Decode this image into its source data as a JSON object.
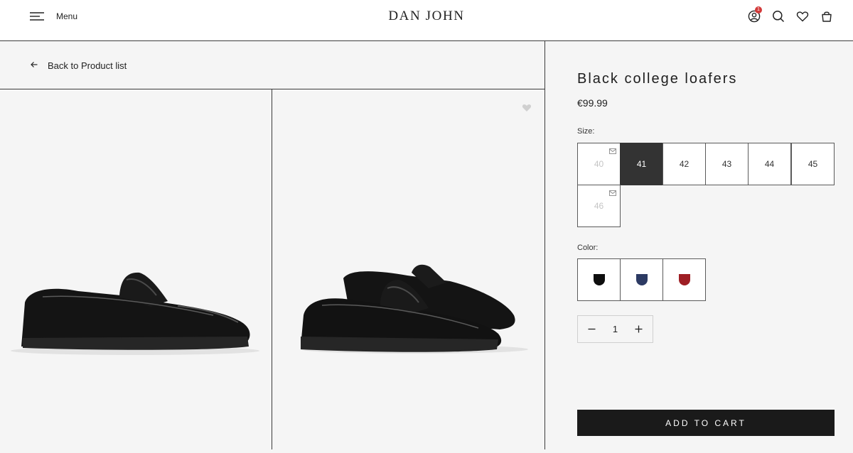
{
  "header": {
    "menu_label": "Menu",
    "brand": "DAN JOHN",
    "account_badge": "1",
    "icons": [
      "menu-icon",
      "account-icon",
      "search-icon",
      "heart-icon",
      "bag-icon"
    ]
  },
  "nav": {
    "back_label": "Back to Product list"
  },
  "product": {
    "title": "Black college loafers",
    "price": "€99.99",
    "size_label": "Size:",
    "sizes": [
      {
        "label": "40",
        "state": "unavailable"
      },
      {
        "label": "41",
        "state": "selected"
      },
      {
        "label": "42",
        "state": "available"
      },
      {
        "label": "43",
        "state": "available"
      },
      {
        "label": "44",
        "state": "available"
      },
      {
        "label": "45",
        "state": "available"
      },
      {
        "label": "46",
        "state": "unavailable"
      }
    ],
    "color_label": "Color:",
    "colors": [
      {
        "name": "black",
        "hex": "#0e0e0e"
      },
      {
        "name": "navy",
        "hex": "#2c3a63"
      },
      {
        "name": "burgundy",
        "hex": "#9e1e24"
      }
    ],
    "quantity": "1",
    "add_to_cart": "ADD TO CART"
  },
  "colors": {
    "accent_dark": "#1a1a1a",
    "badge": "#d33a3a",
    "background": "#f5f5f5"
  }
}
